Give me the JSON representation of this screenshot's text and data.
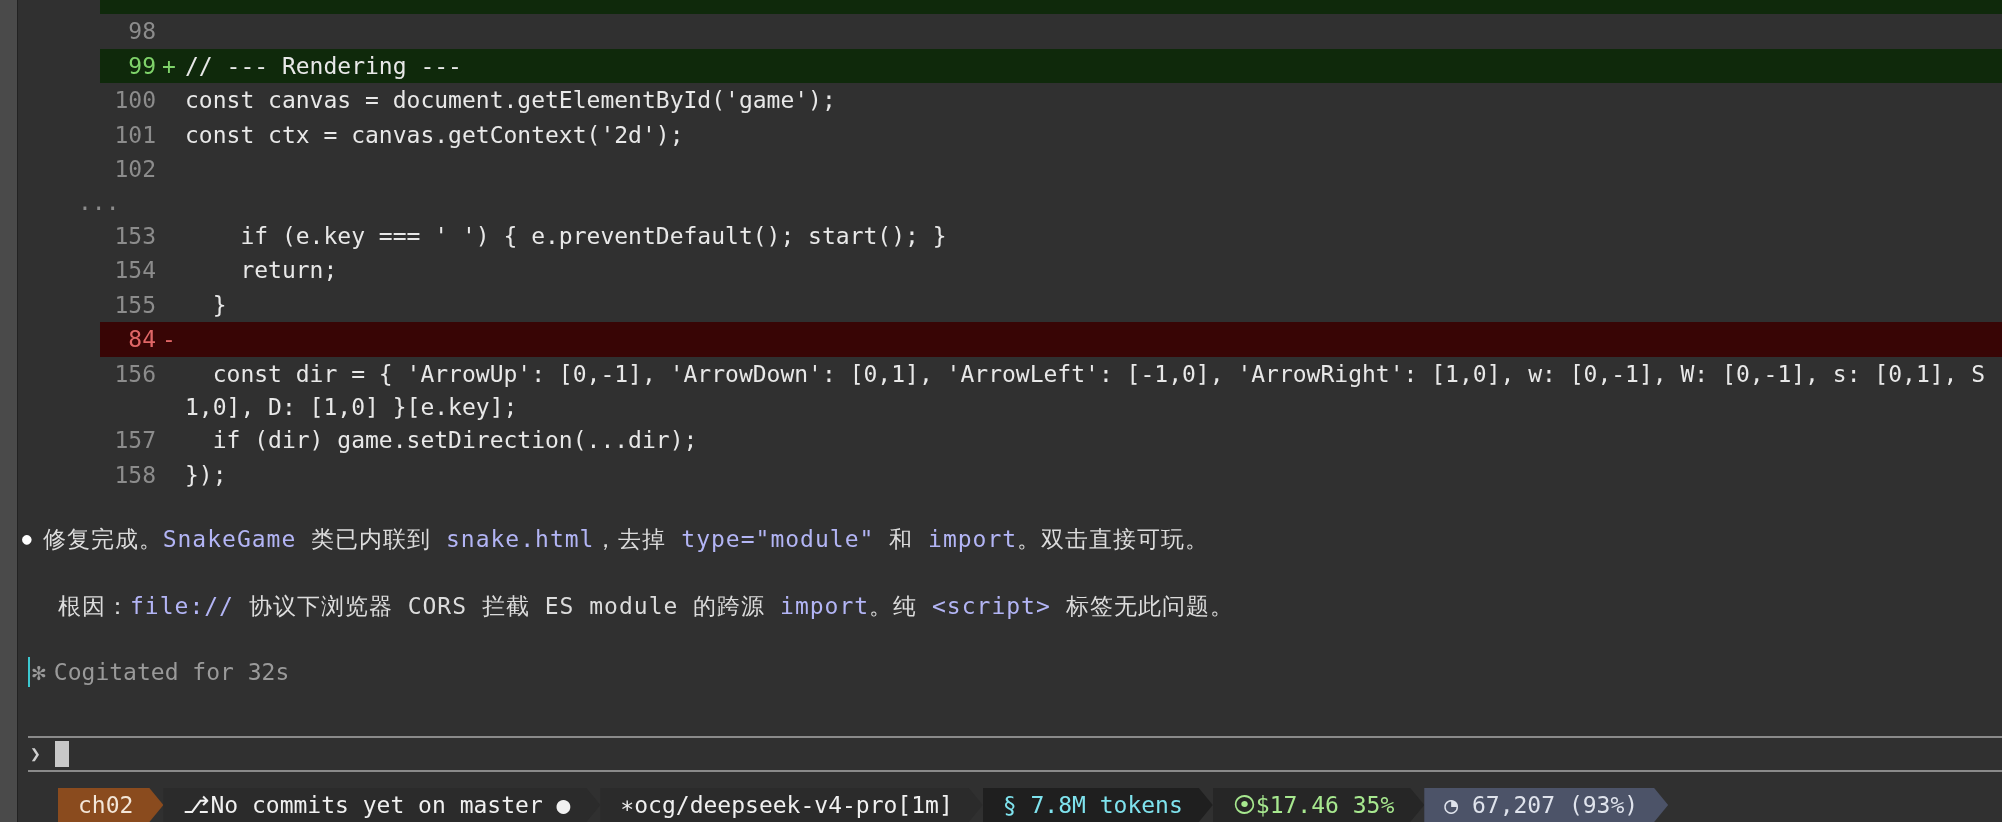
{
  "diff": {
    "lines": [
      {
        "kind": "added-edge"
      },
      {
        "kind": "context",
        "number": "98"
      },
      {
        "kind": "added",
        "number": "99",
        "marker": "+",
        "code": "// --- Rendering ---"
      },
      {
        "kind": "context",
        "number": "100",
        "code": "const canvas = document.getElementById('game');"
      },
      {
        "kind": "context",
        "number": "101",
        "code": "const ctx = canvas.getContext('2d');"
      },
      {
        "kind": "context",
        "number": "102"
      },
      {
        "kind": "ellipsis",
        "code": "..."
      },
      {
        "kind": "context",
        "number": "153",
        "code": "    if (e.key === ' ') { e.preventDefault(); start(); }"
      },
      {
        "kind": "context",
        "number": "154",
        "code": "    return;"
      },
      {
        "kind": "context",
        "number": "155",
        "code": "  }"
      },
      {
        "kind": "removed",
        "number": "84",
        "marker": "-"
      },
      {
        "kind": "context",
        "number": "156",
        "code": "  const dir = { 'ArrowUp': [0,-1], 'ArrowDown': [0,1], 'ArrowLeft': [-1,0], 'ArrowRight': [1,0], w: [0,-1], W: [0,-1], s: [0,1], S",
        "continuation": "1,0], D: [1,0] }[e.key];"
      },
      {
        "kind": "context",
        "number": "157",
        "code": "  if (dir) game.setDirection(...dir);"
      },
      {
        "kind": "context",
        "number": "158",
        "code": "});"
      }
    ]
  },
  "message": {
    "bullet": "●",
    "paragraphs": [
      [
        {
          "kind": "plain",
          "text": "修复完成。"
        },
        {
          "kind": "code",
          "text": "SnakeGame"
        },
        {
          "kind": "plain",
          "text": " 类已内联到 "
        },
        {
          "kind": "code",
          "text": "snake.html"
        },
        {
          "kind": "plain",
          "text": "，去掉 "
        },
        {
          "kind": "code",
          "text": "type=\"module\""
        },
        {
          "kind": "plain",
          "text": " 和 "
        },
        {
          "kind": "code",
          "text": "import"
        },
        {
          "kind": "plain",
          "text": "。双击直接可玩。"
        }
      ],
      [
        {
          "kind": "plain",
          "text": "根因："
        },
        {
          "kind": "code",
          "text": "file://"
        },
        {
          "kind": "plain",
          "text": " 协议下浏览器 CORS 拦截 ES module 的跨源 "
        },
        {
          "kind": "code",
          "text": "import"
        },
        {
          "kind": "plain",
          "text": "。纯 "
        },
        {
          "kind": "code",
          "text": "<script>"
        },
        {
          "kind": "plain",
          "text": " 标签无此问题。"
        }
      ]
    ]
  },
  "status": {
    "symbol": "✻",
    "text": "Cogitated for 32s"
  },
  "prompt": {
    "symbol": "❯"
  },
  "status_bar": [
    {
      "kind": "brand",
      "text": "ch02",
      "color": "#8a4b1e"
    },
    {
      "kind": "plain",
      "text": "⎇No commits yet on master ●",
      "color": "#2b2b2b"
    },
    {
      "kind": "plain",
      "text": "∗ocg/deepseek-v4-pro[1m]",
      "color": "#2b2b2b"
    },
    {
      "kind": "tokens",
      "text": "§ 7.8M tokens",
      "color": "#1f1f1f"
    },
    {
      "kind": "cost",
      "text": "⦿$17.46 35%",
      "color": "#262626"
    },
    {
      "kind": "context",
      "text": "◔ 67,207 (93%)",
      "color": "#4c5368"
    }
  ]
}
